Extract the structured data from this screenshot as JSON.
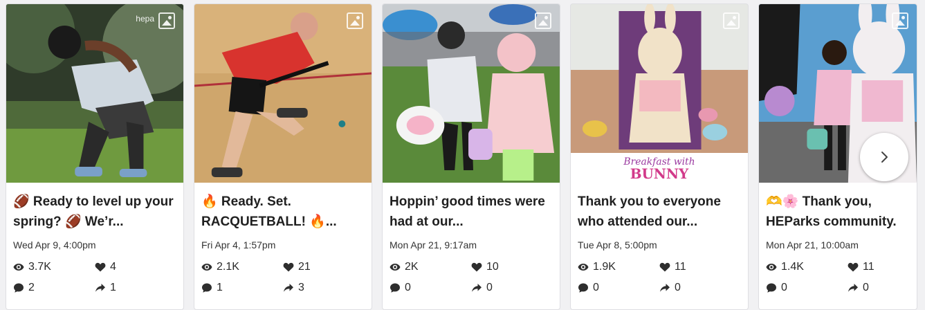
{
  "posts": [
    {
      "caption": "🏈 Ready to level up your spring? 🏈 We’r...",
      "watermark": "hepa",
      "date": "Wed Apr 9, 4:00pm",
      "views": "3.7K",
      "likes": "4",
      "comments": "2",
      "shares": "1"
    },
    {
      "caption": "🔥 Ready. Set. RACQUETBALL! 🔥...",
      "date": "Fri Apr 4, 1:57pm",
      "views": "2.1K",
      "likes": "21",
      "comments": "1",
      "shares": "3"
    },
    {
      "caption": "Hoppin’ good times were had at our...",
      "date": "Mon Apr 21, 9:17am",
      "views": "2K",
      "likes": "10",
      "comments": "0",
      "shares": "0"
    },
    {
      "caption": "Thank you to everyone who attended our...",
      "image_text": [
        "Breakfast with",
        "BUNNY"
      ],
      "date": "Tue Apr 8, 5:00pm",
      "views": "1.9K",
      "likes": "11",
      "comments": "0",
      "shares": "0"
    },
    {
      "caption": "🫶🌸 Thank you, HEParks community.",
      "date": "Mon Apr 21, 10:00am",
      "views": "1.4K",
      "likes": "11",
      "comments": "0",
      "shares": "0"
    }
  ],
  "icons": {
    "views": "eye-icon",
    "likes": "heart-icon",
    "comments": "comment-bubble-icon",
    "shares": "share-arrow-icon",
    "next": "chevron-right-icon",
    "gallery": "image-gallery-icon"
  }
}
